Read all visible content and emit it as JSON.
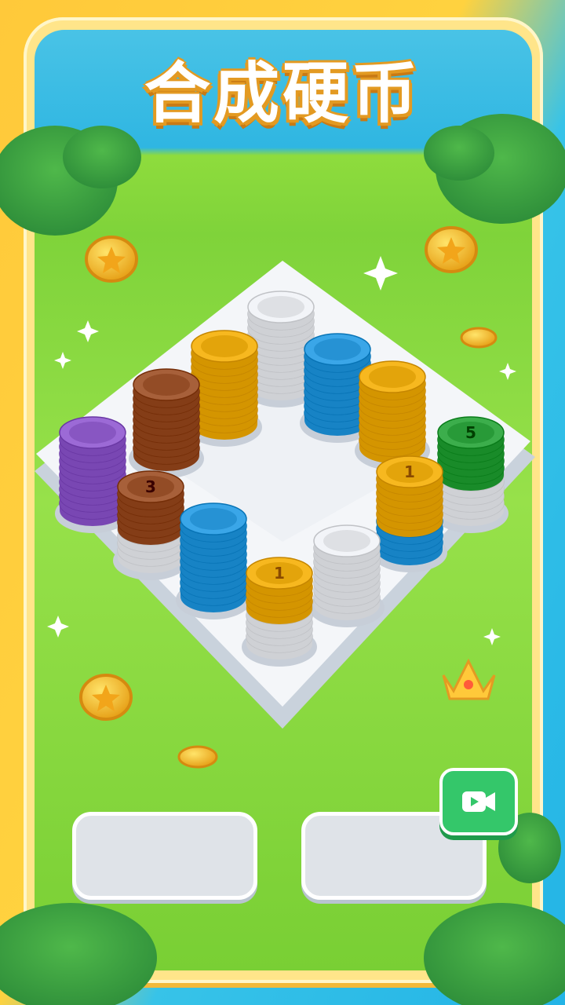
{
  "title": "合成硬币",
  "colors": {
    "white": "#f2f4f8",
    "gold": "#f7b81f",
    "brown": "#a7603a",
    "blue": "#3aa6e8",
    "purple": "#9c6ad6",
    "green": "#3cae4c"
  },
  "stacks": [
    {
      "id": "stack-white-back",
      "layers": [
        {
          "color": "white",
          "count": 11
        }
      ],
      "label": ""
    },
    {
      "id": "stack-gold-left-back",
      "layers": [
        {
          "color": "gold",
          "count": 11
        }
      ],
      "label": ""
    },
    {
      "id": "stack-blue-right-back",
      "layers": [
        {
          "color": "blue",
          "count": 10
        }
      ],
      "label": ""
    },
    {
      "id": "stack-brown-back",
      "layers": [
        {
          "color": "brown",
          "count": 10
        }
      ],
      "label": ""
    },
    {
      "id": "stack-gold-right",
      "layers": [
        {
          "color": "gold",
          "count": 10
        }
      ],
      "label": ""
    },
    {
      "id": "stack-purple",
      "layers": [
        {
          "color": "purple",
          "count": 11
        }
      ],
      "label": ""
    },
    {
      "id": "stack-brown-front",
      "layers": [
        {
          "color": "white",
          "count": 4
        },
        {
          "color": "brown",
          "count": 6
        }
      ],
      "label": "3"
    },
    {
      "id": "stack-green",
      "layers": [
        {
          "color": "white",
          "count": 5
        },
        {
          "color": "green",
          "count": 6
        }
      ],
      "label": "5"
    },
    {
      "id": "stack-blue-gold",
      "layers": [
        {
          "color": "blue",
          "count": 4
        },
        {
          "color": "gold",
          "count": 7
        }
      ],
      "label": "1"
    },
    {
      "id": "stack-blue-front",
      "layers": [
        {
          "color": "blue",
          "count": 11
        }
      ],
      "label": ""
    },
    {
      "id": "stack-white-front",
      "layers": [
        {
          "color": "white",
          "count": 9
        }
      ],
      "label": ""
    },
    {
      "id": "stack-gold-front",
      "layers": [
        {
          "color": "white",
          "count": 5
        },
        {
          "color": "gold",
          "count": 5
        }
      ],
      "label": "1"
    }
  ],
  "icons": {
    "video": "video-camera-icon",
    "crown": "crown-icon",
    "coin": "coin-icon",
    "sparkle": "sparkle-icon"
  }
}
